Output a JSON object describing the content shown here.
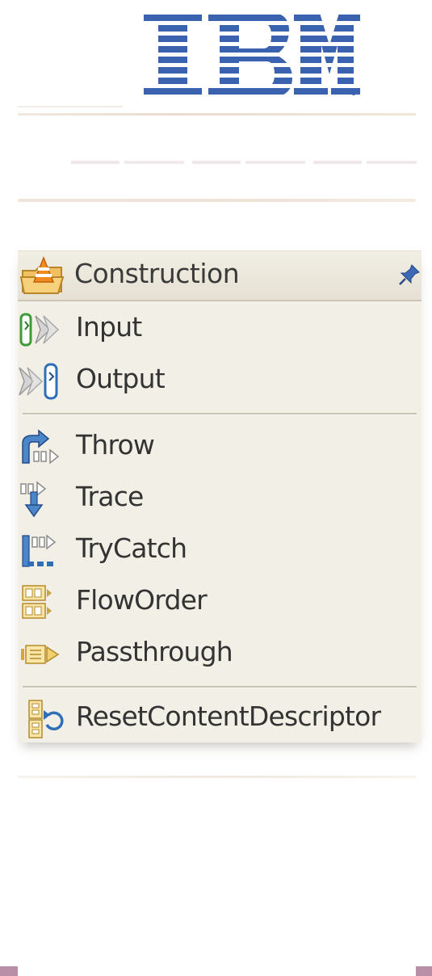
{
  "logo": {
    "text": "IBM",
    "color": "#3a62ae",
    "icon": "ibm-logo"
  },
  "palette": {
    "drawer": {
      "label": "Construction",
      "icon": "folder-cone-icon",
      "pin_icon": "pin-icon"
    },
    "groups": [
      [
        {
          "label": "Input",
          "icon": "input-node-icon"
        },
        {
          "label": "Output",
          "icon": "output-node-icon"
        }
      ],
      [
        {
          "label": "Throw",
          "icon": "throw-node-icon"
        },
        {
          "label": "Trace",
          "icon": "trace-node-icon"
        },
        {
          "label": "TryCatch",
          "icon": "trycatch-node-icon"
        },
        {
          "label": "FlowOrder",
          "icon": "floworder-node-icon"
        },
        {
          "label": "Passthrough",
          "icon": "passthrough-node-icon"
        }
      ],
      [
        {
          "label": "ResetContentDescriptor",
          "icon": "resetcontentdescriptor-node-icon"
        }
      ]
    ]
  },
  "colors": {
    "palette_bg": "#f2f0e6",
    "header_bg": "#e6e1d3",
    "separator": "#c9c3b4",
    "text": "#333333",
    "node_blue": "#2f6fb8",
    "node_green": "#3f9a3a",
    "node_gold": "#d9a635",
    "node_grey": "#a9a9a9"
  }
}
